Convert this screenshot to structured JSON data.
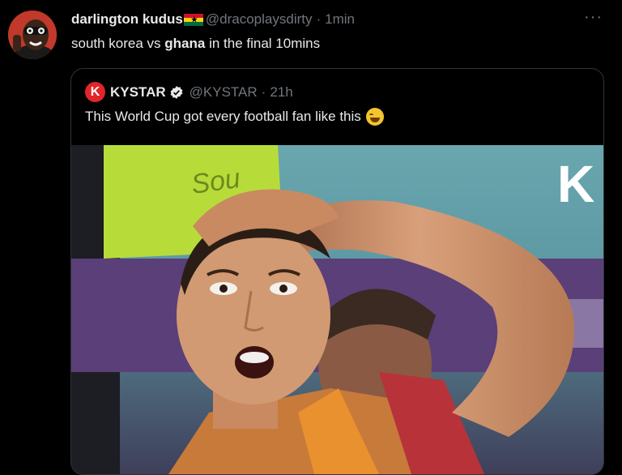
{
  "tweet": {
    "display_name": "darlington kudus",
    "handle": "@dracoplaysdirty",
    "separator": "·",
    "time": "1min",
    "text_before": "south korea vs ",
    "text_bold": "ghana",
    "text_after": " in the final 10mins",
    "more": "···"
  },
  "quoted_tweet": {
    "logo_letter": "K",
    "display_name": "KYSTAR",
    "handle": "@KYSTAR",
    "separator": "·",
    "time": "21h",
    "text": "This World Cup got every football fan like this",
    "emoji": "face-with-tears-of-joy",
    "media_watermark": "K"
  },
  "colors": {
    "background": "#000000",
    "text": "#e7e9ea",
    "muted": "#71767b",
    "border": "#2f3336",
    "verified": "#1d9bf0",
    "brand": "#e0262a"
  }
}
